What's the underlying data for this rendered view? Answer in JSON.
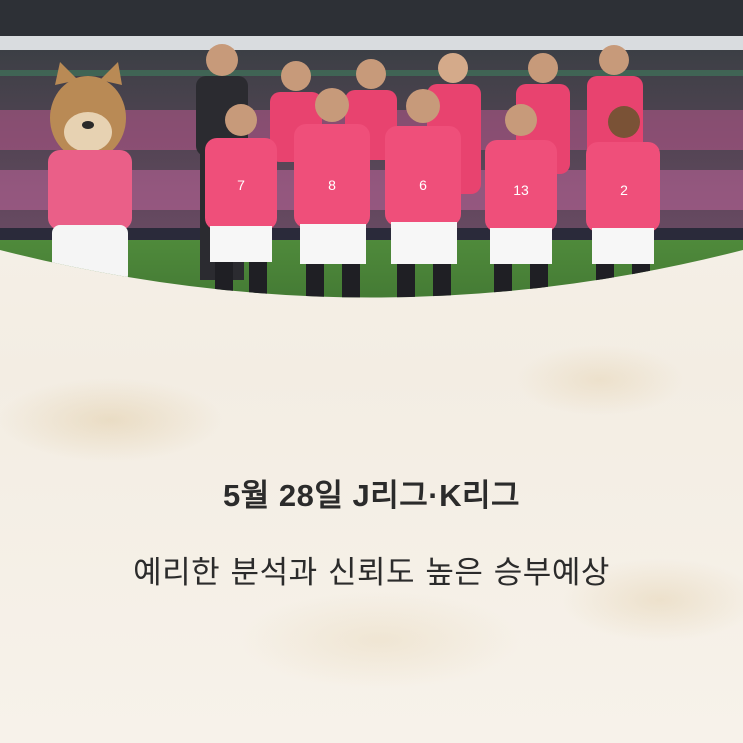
{
  "card": {
    "title": "5월 28일 J리그·K리그",
    "subtitle": "예리한 분석과 신뢰도 높은 승부예상"
  },
  "photo": {
    "subject": "team-photo",
    "kit_color": "#e8436f",
    "players": [
      {
        "number": "7"
      },
      {
        "number": "8"
      },
      {
        "number": "6"
      },
      {
        "number": "13"
      },
      {
        "number": "2"
      }
    ]
  }
}
